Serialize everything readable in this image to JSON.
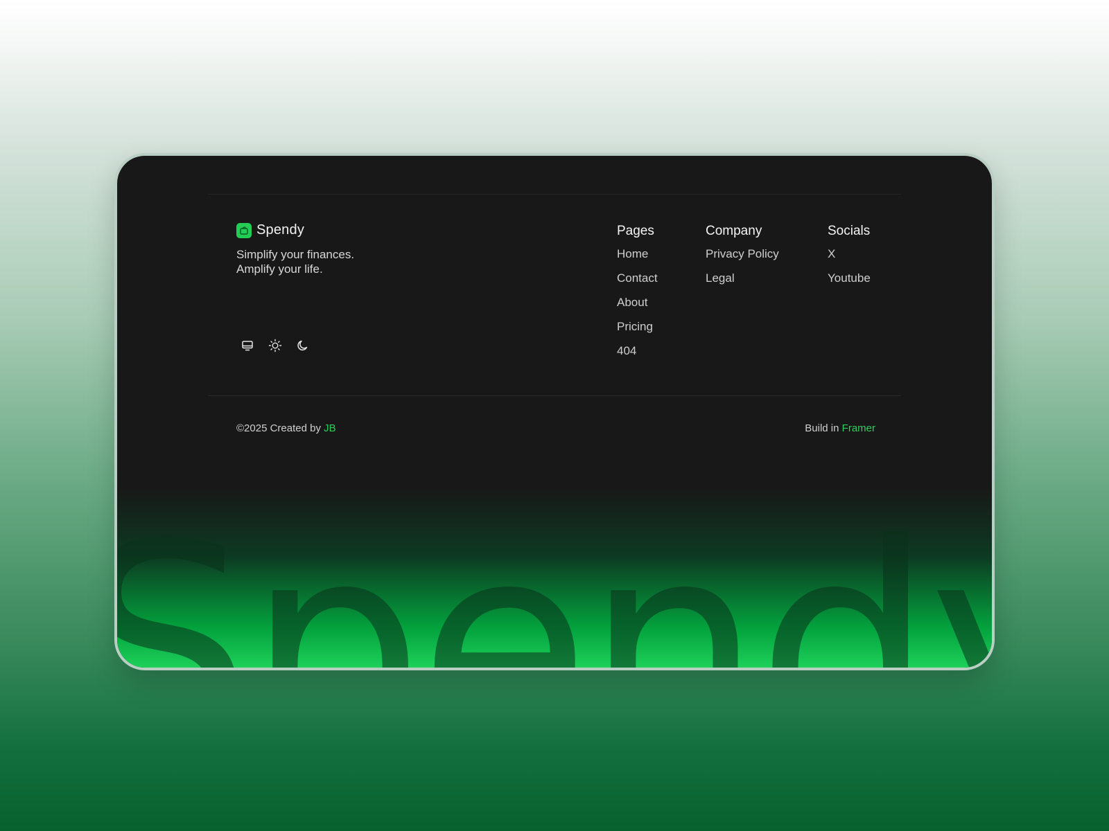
{
  "brand": {
    "name": "Spendy",
    "tagline_line1": "Simplify your finances.",
    "tagline_line2": "Amplify your life.",
    "logo_color": "#22cc55",
    "watermark": "Spendy"
  },
  "theme_switcher": {
    "icons": [
      "monitor-icon",
      "sun-icon",
      "moon-icon"
    ]
  },
  "columns": {
    "pages": {
      "title": "Pages",
      "links": [
        "Home",
        "Contact",
        "About",
        "Pricing",
        "404"
      ]
    },
    "company": {
      "title": "Company",
      "links": [
        "Privacy Policy",
        "Legal"
      ]
    },
    "socials": {
      "title": "Socials",
      "links": [
        "X",
        "Youtube"
      ]
    }
  },
  "footer": {
    "copyright_prefix": "©2025 Created by ",
    "author": "JB",
    "build_prefix": "Build in ",
    "build_tool": "Framer"
  },
  "colors": {
    "card_bg": "#181818",
    "accent": "#2fcf5c",
    "glow": "#03a23d"
  }
}
